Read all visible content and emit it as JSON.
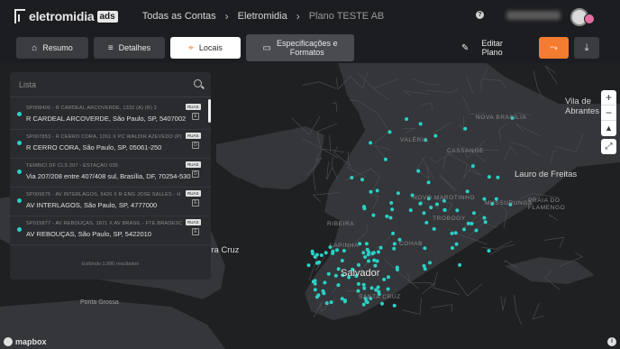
{
  "brand": {
    "name": "eletromidia",
    "badge": "ads"
  },
  "breadcrumb": [
    "Todas as Contas",
    "Eletromidia",
    "Plano TESTE AB"
  ],
  "tabs": [
    {
      "label": "Resumo",
      "icon": "basket-icon"
    },
    {
      "label": "Detalhes",
      "icon": "list-icon"
    },
    {
      "label": "Locais",
      "icon": "pin-icon",
      "active": true
    },
    {
      "label_line1": "Especificações e",
      "label_line2": "Formatos",
      "icon": "panel-icon"
    }
  ],
  "actions": {
    "edit_line1": "Editar",
    "edit_line2": "Plano"
  },
  "search": {
    "placeholder": "Lista"
  },
  "locations": [
    {
      "code": "SP008400 - R CARDEAL ARCOVERDE, 1332 (A) (R) 2",
      "address": "R CARDEAL ARCOVERDE, São Paulo, SP, 5407002",
      "tag": "RUAS"
    },
    {
      "code": "SP007853 - R CERRO CORA, 1261 X PC WALDIR AZEVEDO (P)",
      "address": "R CERRO CORA, São Paulo, SP, 05061-250",
      "tag": "RUAS"
    },
    {
      "code": "TEMBICI DF CLS 207 - ESTAÇÃO 035",
      "address": "Via 207/208 entre 407/408 sul, Brasília, DF, 70254-530",
      "tag": "RUAS"
    },
    {
      "code": "SP009675 - AV INTERLAGOS, 5420 X R ENG JOSE SALLES - H",
      "address": "AV INTERLAGOS, São Paulo, SP, 4777000",
      "tag": "RUAS"
    },
    {
      "code": "SP015877 - AV REBOUÇAS, 1871 X AV BRASIL - FTE BRADESC",
      "address": "AV REBOUÇAS, São Paulo, SP, 5422010",
      "tag": "RUAS"
    }
  ],
  "footer": "Exibindo 1.896 resultados",
  "map": {
    "labels": {
      "city": "Salvador",
      "lauro": "Lauro de Freitas",
      "vila": "Vila de Abrantes",
      "cruz": "era Cruz",
      "ponta": "Ponta Grossa",
      "nova": "NOVA BRASÍLIA",
      "valeria": "VALÉRIA",
      "cassange": "CASSANGE",
      "novo": "NOVO MAROTINHO",
      "mussurunga": "MUSSURUNGA",
      "praia": "PRAIA DO FLAMENGO",
      "trobogy": "TROBOGY",
      "cajazeiras": "CAJAZEIRAS",
      "lapinha": "LAPINHA",
      "ribeira": "RIBEIRA",
      "cohab": "COHAB",
      "santa": "SANTA CRUZ"
    },
    "point_color": "#2ad1c6",
    "attribution": "mapbox"
  }
}
